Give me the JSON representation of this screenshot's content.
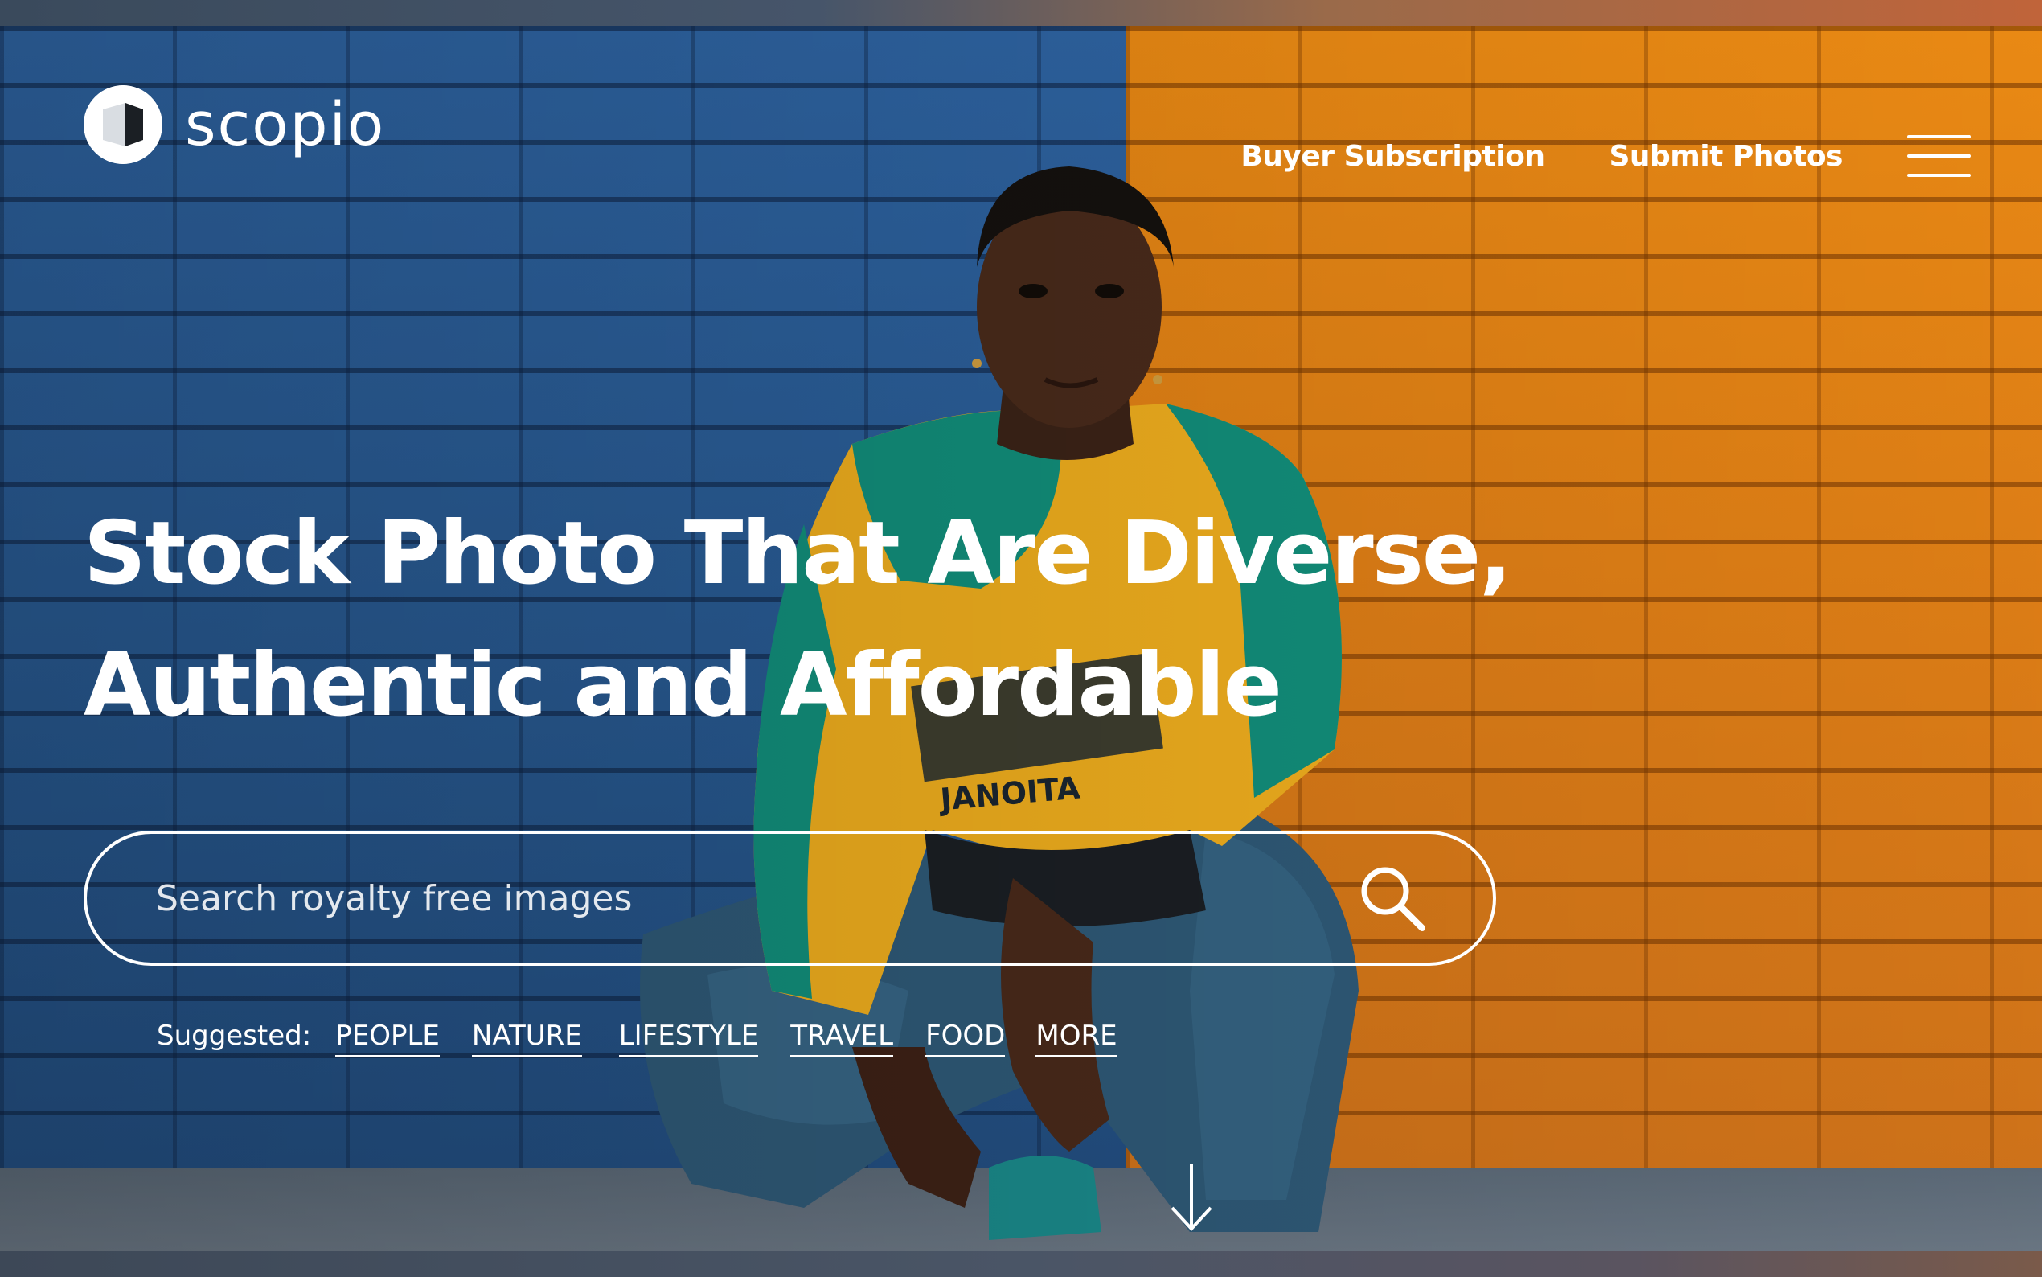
{
  "brand": {
    "name": "scopio",
    "logo_icon": "scopio-logo-icon"
  },
  "nav": {
    "links": [
      {
        "label": "Buyer Subscription"
      },
      {
        "label": "Submit Photos"
      }
    ],
    "menu_icon": "hamburger-menu-icon"
  },
  "hero": {
    "headline_line1": "Stock Photo That Are Diverse,",
    "headline_line2": "Authentic and Affordable"
  },
  "search": {
    "placeholder": "Search royalty free images",
    "value": "",
    "icon": "search-icon"
  },
  "suggested": {
    "label": "Suggested:",
    "tags": [
      "PEOPLE",
      "NATURE",
      "LIFESTYLE",
      "TRAVEL",
      "FOOD",
      "MORE"
    ]
  },
  "scroll": {
    "icon": "arrow-down-icon"
  },
  "colors": {
    "wall_blue": "#2d62a0",
    "wall_orange": "#e0841a",
    "text": "#ffffff"
  }
}
